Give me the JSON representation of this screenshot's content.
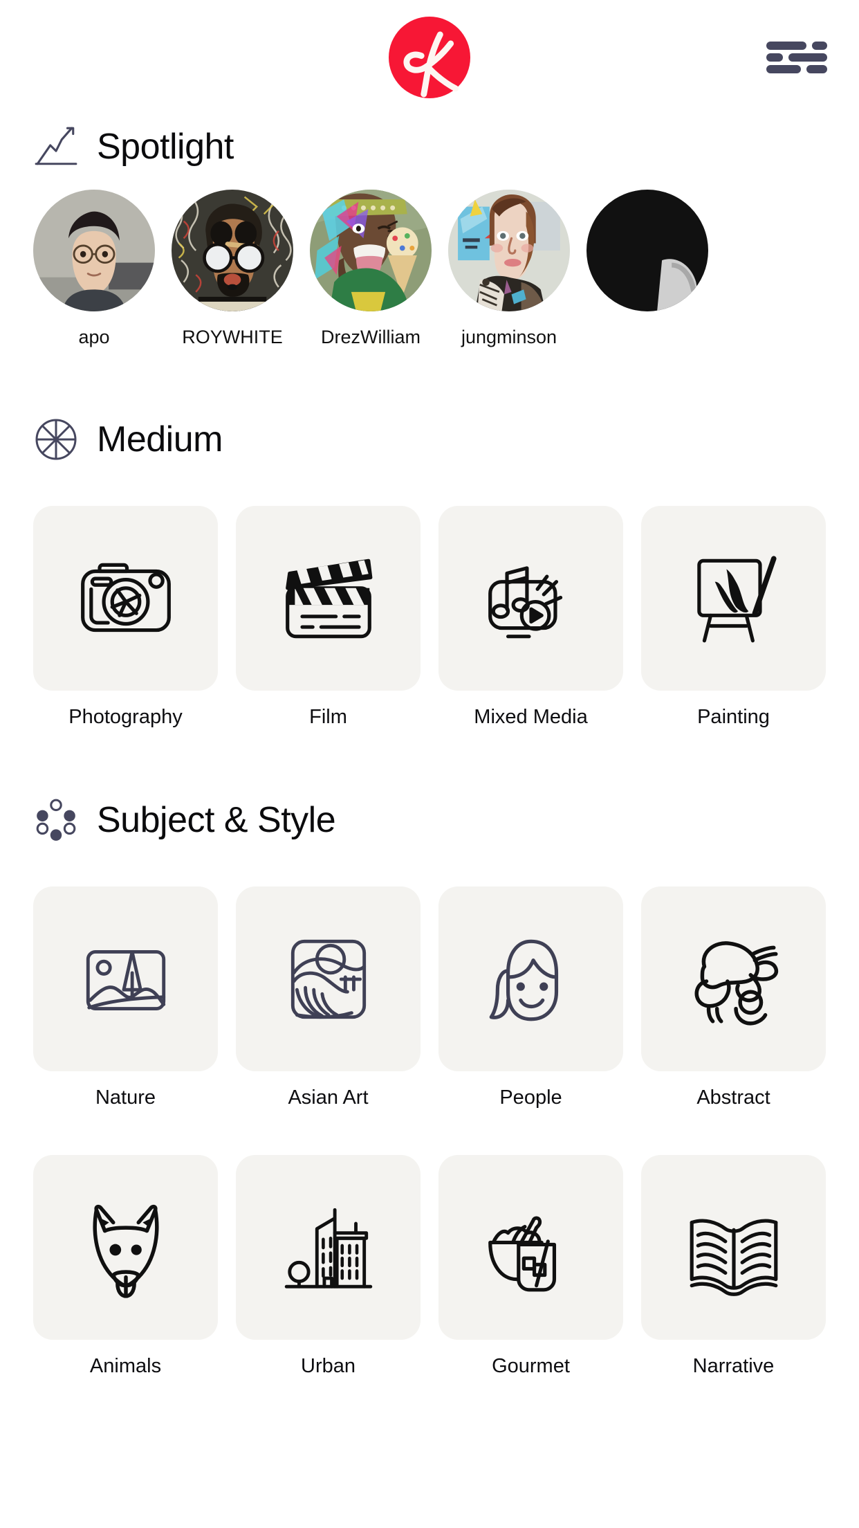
{
  "header": {
    "logo_name": "ck-logo",
    "logo_color": "#f71735",
    "menu_label": "Menu",
    "menu_icon": "hamburger-menu-icon"
  },
  "spotlight": {
    "title": "Spotlight",
    "icon": "trending-chart-icon",
    "artists": [
      {
        "name": "apo",
        "avatar": "photo-portrait-man-glasses"
      },
      {
        "name": "ROYWHITE",
        "avatar": "illustration-man-sunglasses-beard"
      },
      {
        "name": "DrezWilliam",
        "avatar": "digital-art-man-ice-cream"
      },
      {
        "name": "jungminson",
        "avatar": "painting-portrait-woman"
      },
      {
        "name": "",
        "avatar": "photo-dark-partial"
      }
    ]
  },
  "medium": {
    "title": "Medium",
    "icon": "wheel-spokes-icon",
    "items": [
      {
        "label": "Photography",
        "icon": "camera-icon"
      },
      {
        "label": "Film",
        "icon": "clapperboard-icon"
      },
      {
        "label": "Mixed Media",
        "icon": "music-play-icon"
      },
      {
        "label": "Painting",
        "icon": "easel-brush-icon"
      }
    ]
  },
  "subject_style": {
    "title": "Subject & Style",
    "icon": "dots-pattern-icon",
    "items": [
      {
        "label": "Nature",
        "icon": "landscape-icon"
      },
      {
        "label": "Asian Art",
        "icon": "wave-sun-icon"
      },
      {
        "label": "People",
        "icon": "face-smile-icon"
      },
      {
        "label": "Abstract",
        "icon": "abstract-shapes-icon"
      },
      {
        "label": "Animals",
        "icon": "cat-face-icon"
      },
      {
        "label": "Urban",
        "icon": "buildings-icon"
      },
      {
        "label": "Gourmet",
        "icon": "bowl-drink-icon"
      },
      {
        "label": "Narrative",
        "icon": "open-book-icon"
      }
    ]
  },
  "colors": {
    "brand_red": "#f71735",
    "tile_bg": "#f4f3f0",
    "ink": "#0d0d10",
    "slate": "#46475f"
  }
}
